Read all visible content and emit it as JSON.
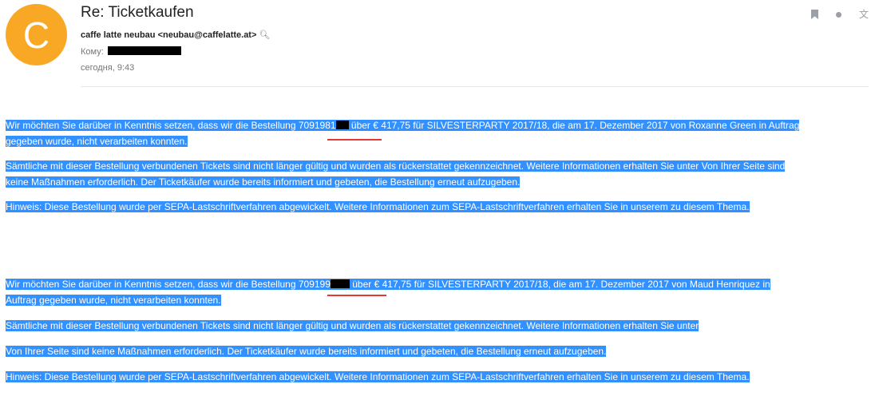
{
  "avatar": {
    "letter": "C",
    "color": "#f9a825"
  },
  "email": {
    "subject": "Re: Ticketkaufen",
    "from": "caffe latte neubau <neubau@caffelatte.at>",
    "to_label": "Кому:",
    "date": "сегодня, 9:43"
  },
  "body": {
    "block1": {
      "p1a": "Wir möchten Sie darüber in Kenntnis setzen, dass wir die Bestellung 7091981",
      "p1b": " über € 417,75 für SILVESTERPARTY 2017/18, die am 17. Dezember 2017 von Roxanne Green in Auftrag",
      "p1c": "gegeben wurde, nicht verarbeiten konnten.",
      "p2a": "Sämtliche mit dieser Bestellung verbundenen Tickets sind nicht länger gültig und wurden als rückerstattet gekennzeichnet. Weitere Informationen erhalten Sie unter Von Ihrer Seite sind",
      "p2b": "keine Maßnahmen erforderlich. Der Ticketkäufer wurde bereits informiert und gebeten, die Bestellung erneut aufzugeben.",
      "p3": "Hinweis: Diese Bestellung wurde per SEPA-Lastschriftverfahren abgewickelt. Weitere Informationen zum SEPA-Lastschriftverfahren erhalten Sie in unserem zu diesem Thema."
    },
    "block2": {
      "p1a": "Wir möchten Sie darüber in Kenntnis setzen, dass wir die Bestellung 709199",
      "p1b": " über € 417,75 für SILVESTERPARTY 2017/18, die am 17. Dezember 2017 von Maud Henriquez in",
      "p1c": "Auftrag gegeben wurde, nicht verarbeiten konnten.",
      "p2": "Sämtliche mit dieser Bestellung verbundenen Tickets sind nicht länger gültig und wurden als rückerstattet gekennzeichnet. Weitere Informationen erhalten Sie unter",
      "p3": "Von Ihrer Seite sind keine Maßnahmen erforderlich. Der Ticketkäufer wurde bereits informiert und gebeten, die Bestellung erneut aufzugeben.",
      "p4": "Hinweis: Diese Bestellung wurde per SEPA-Lastschriftverfahren abgewickelt. Weitere Informationen zum SEPA-Lastschriftverfahren erhalten Sie in unserem zu diesem Thema."
    }
  },
  "colors": {
    "selection": "#3390ff",
    "underline": "#e53935"
  }
}
